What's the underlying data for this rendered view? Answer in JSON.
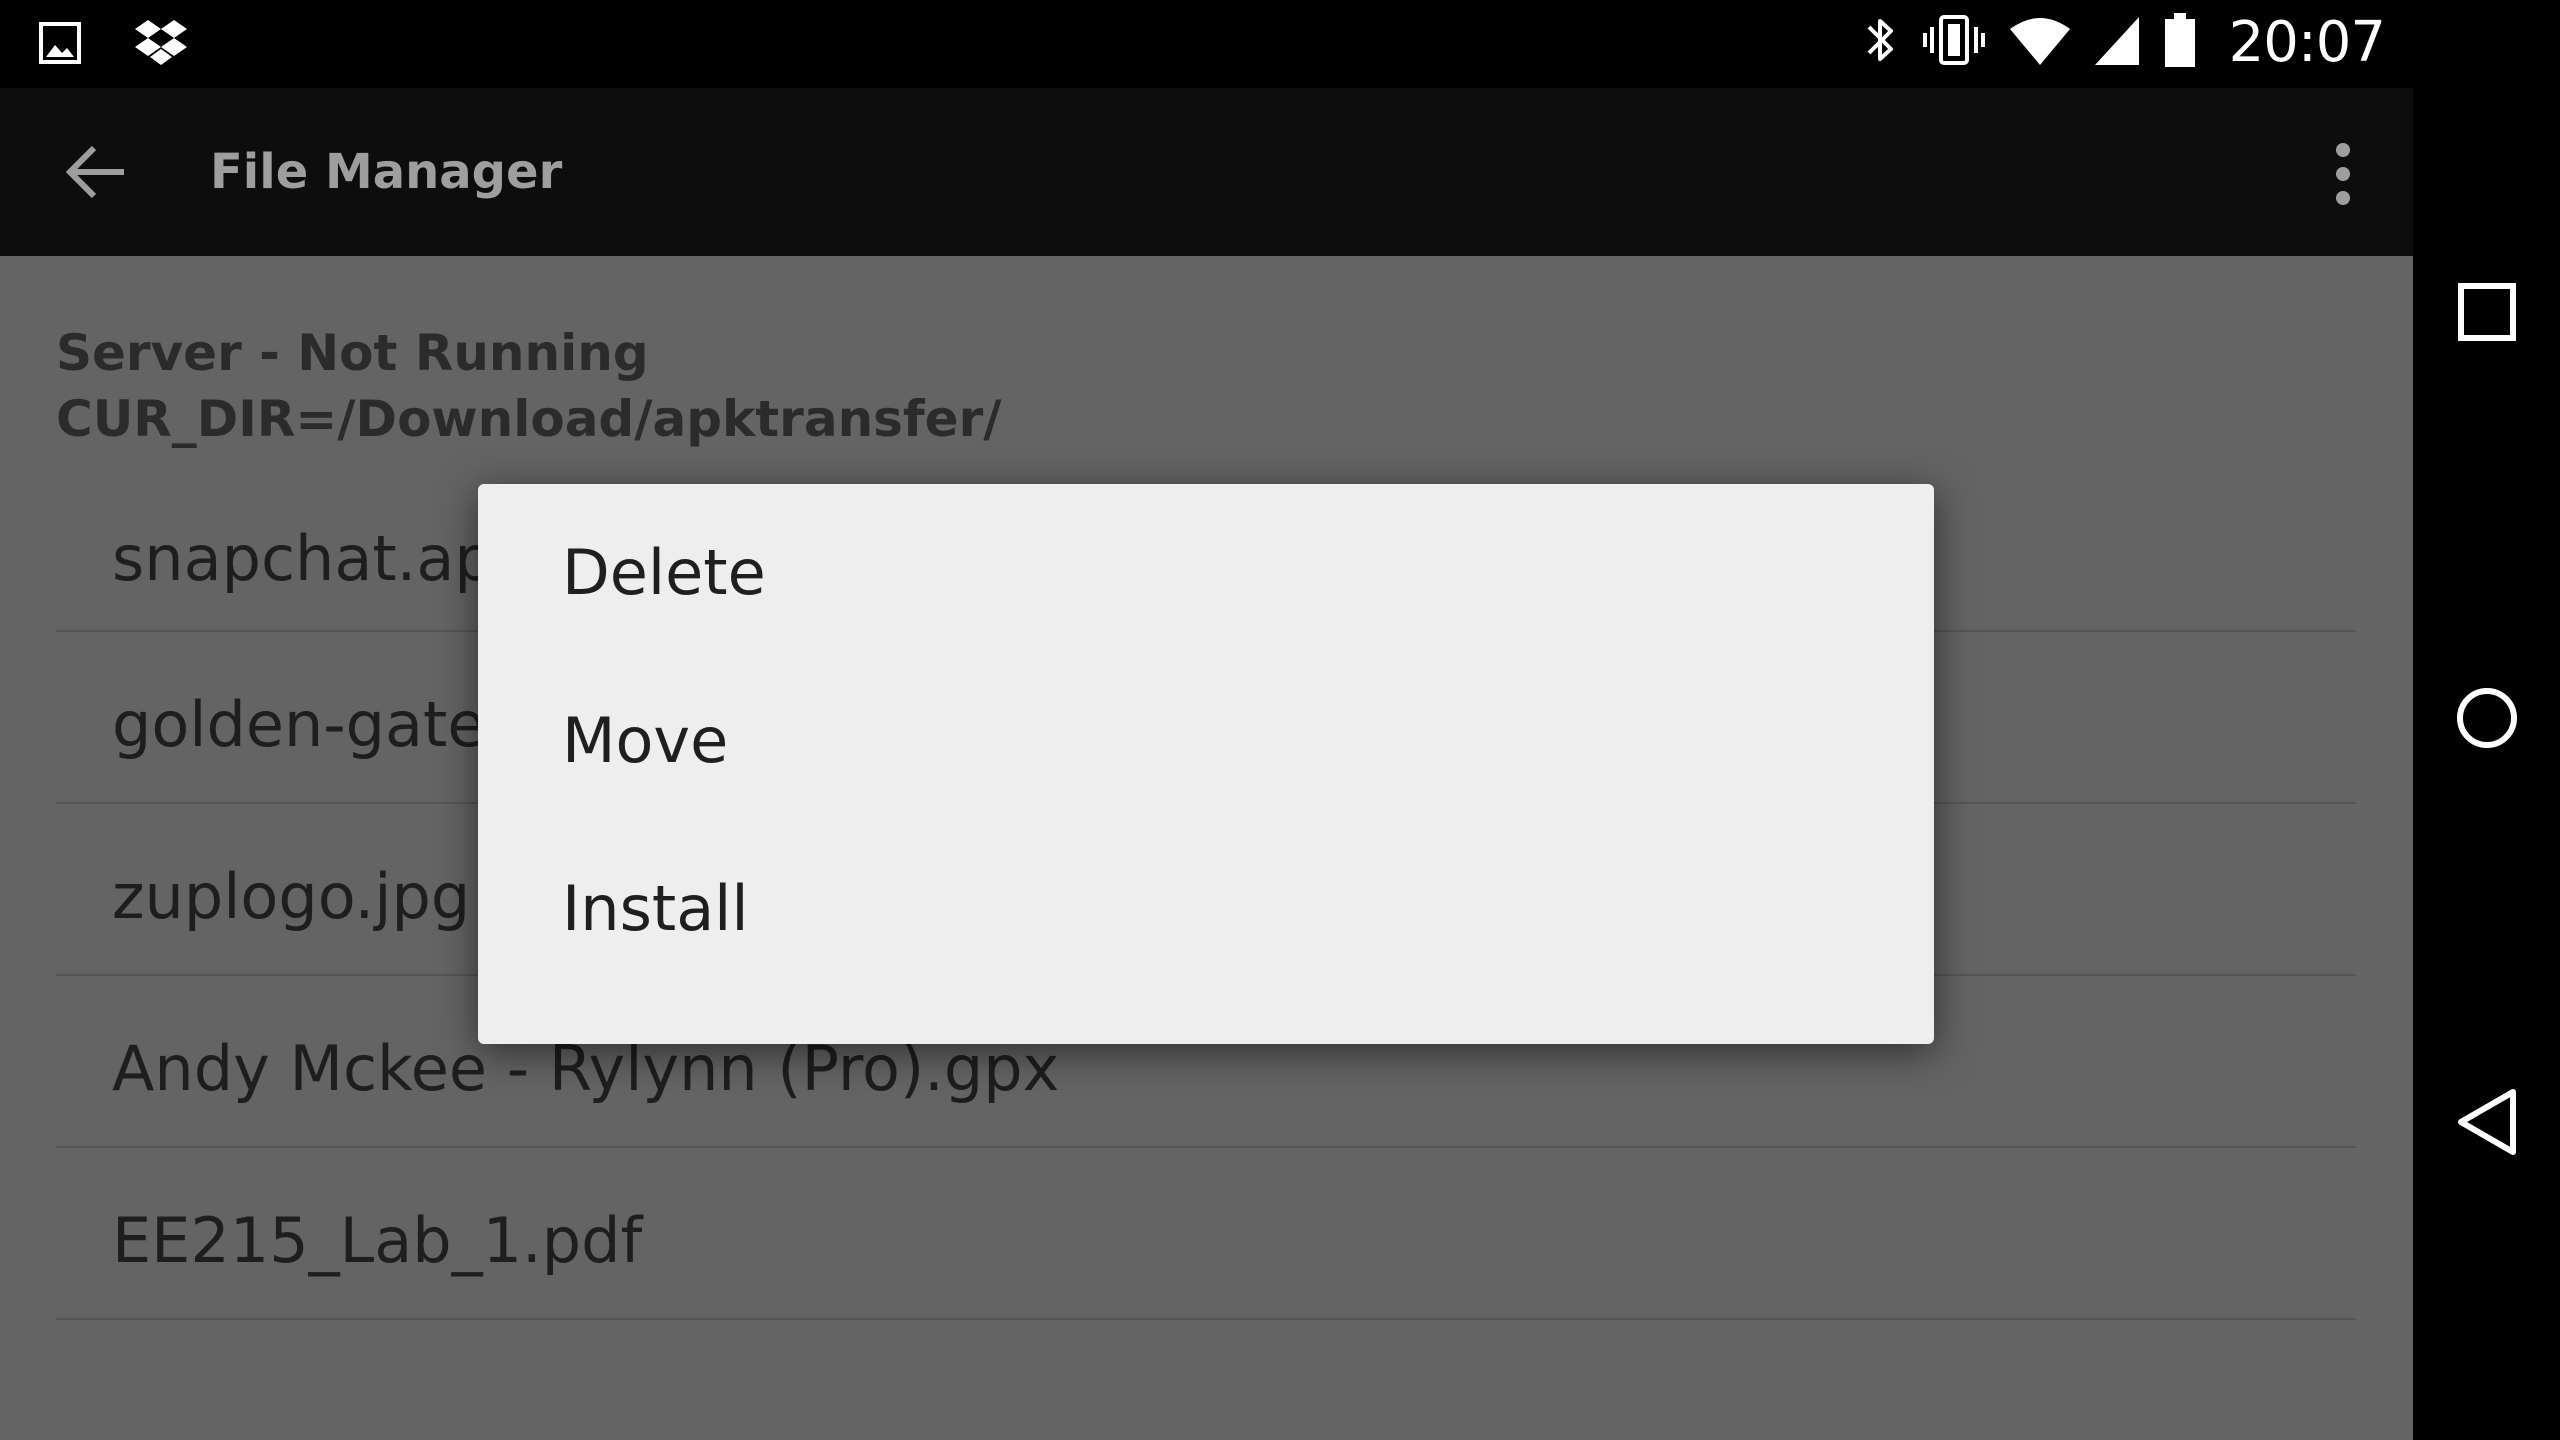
{
  "status_bar": {
    "left_icons": [
      "image-icon",
      "dropbox-icon"
    ],
    "right_icons": [
      "bluetooth-icon",
      "vibrate-icon",
      "wifi-icon",
      "cell-signal-icon",
      "battery-icon"
    ],
    "clock": "20:07"
  },
  "toolbar": {
    "title": "File Manager",
    "back_icon": "arrow-back-icon",
    "overflow_icon": "more-vert-icon"
  },
  "content": {
    "server_status": "Server - Not Running",
    "current_dir": "CUR_DIR=/Download/apktransfer/",
    "files": [
      {
        "name": "snapchat.apk"
      },
      {
        "name": "golden-gate-bridge.jpg"
      },
      {
        "name": "zuplogo.jpg"
      },
      {
        "name": "Andy Mckee - Rylynn (Pro).gpx"
      },
      {
        "name": "EE215_Lab_1.pdf"
      }
    ]
  },
  "dialog": {
    "items": [
      {
        "label": "Delete"
      },
      {
        "label": "Move"
      },
      {
        "label": "Install"
      }
    ]
  },
  "nav_bar": {
    "buttons": [
      "recents-icon",
      "home-icon",
      "back-nav-icon"
    ]
  },
  "colors": {
    "status_bar_bg": "#000000",
    "toolbar_bg": "#0d0d0d",
    "content_dim_bg": "#646464",
    "dialog_bg": "#eeeeee",
    "title_text": "#9e9e9e"
  }
}
